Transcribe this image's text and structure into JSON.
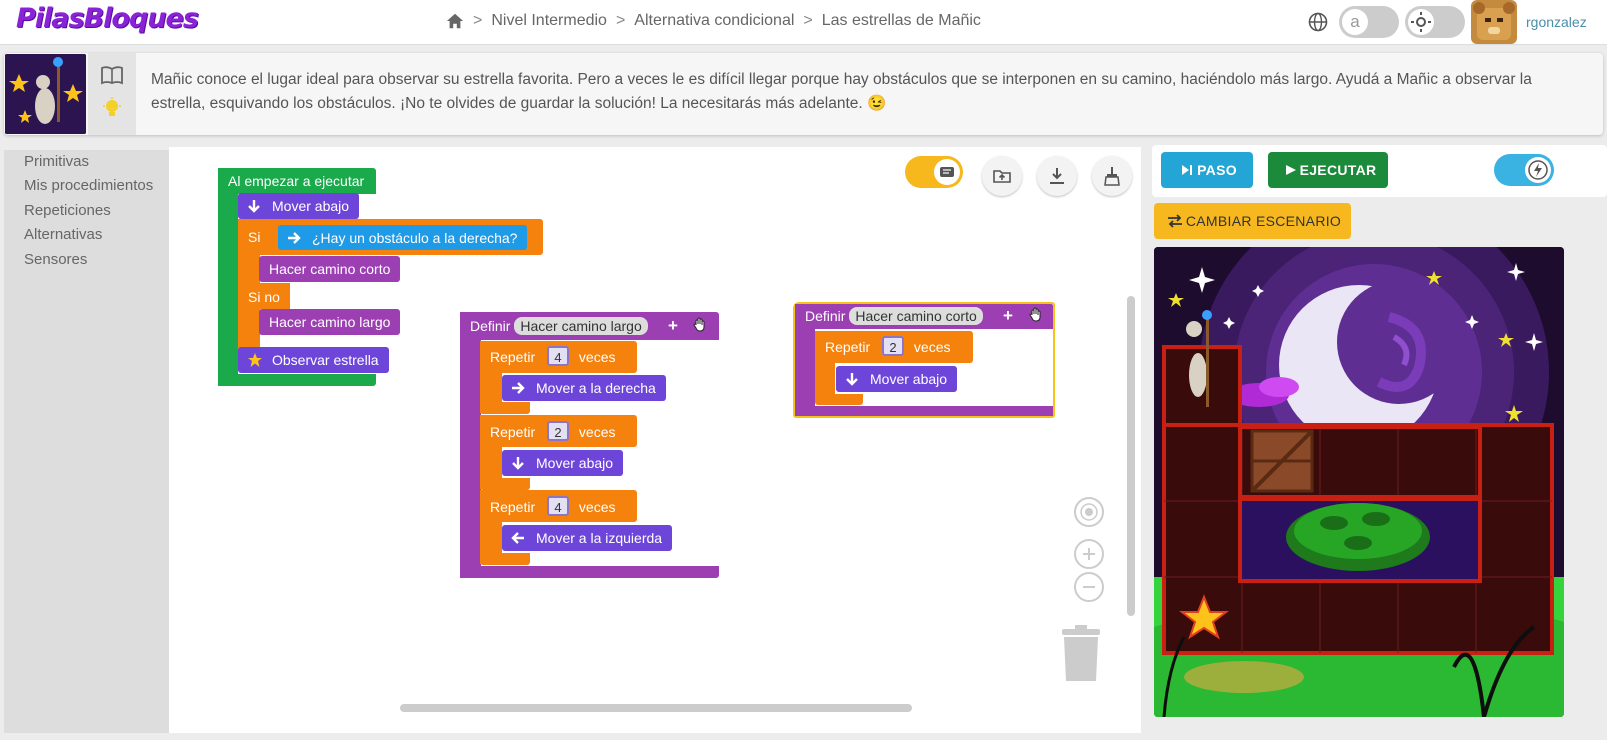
{
  "header": {
    "logo": "PilasBloques",
    "breadcrumb": [
      "Nivel Intermedio",
      "Alternativa condicional",
      "Las estrellas de Mañic"
    ],
    "separator": ">",
    "toggle_font_label": "a",
    "username": "rgonzalez"
  },
  "description": {
    "text": "Mañic conoce el lugar ideal para observar su estrella favorita. Pero a veces le es difícil llegar porque hay obstáculos que se interponen en su camino, haciéndolo más largo. Ayudá a Mañic a observar la estrella, esquivando los obstáculos. ¡No te olvides de guardar la solución! La necesitarás más adelante. 😉"
  },
  "toolbox": {
    "items": [
      "Primitivas",
      "Mis procedimientos",
      "Repeticiones",
      "Alternativas",
      "Sensores"
    ]
  },
  "workspace": {
    "main": {
      "hat": "Al empezar a ejecutar",
      "move_down": "Mover abajo",
      "if_label": "Si",
      "condition": "¿Hay un obstáculo a la derecha?",
      "short_path": "Hacer camino corto",
      "else_label": "Si no",
      "long_path": "Hacer camino largo",
      "observe": "Observar estrella"
    },
    "def_long": {
      "define": "Definir",
      "name": "Hacer camino largo",
      "plus": "+",
      "repeat_label": "Repetir",
      "times_label": "veces",
      "r1_count": "4",
      "r1_action": "Mover a la derecha",
      "r2_count": "2",
      "r2_action": "Mover abajo",
      "r3_count": "4",
      "r3_action": "Mover a la izquierda"
    },
    "def_short": {
      "define": "Definir",
      "name": "Hacer camino corto",
      "plus": "+",
      "repeat_label": "Repetir",
      "times_label": "veces",
      "count": "2",
      "action": "Mover abajo"
    }
  },
  "controls": {
    "step": "PASO",
    "run": "EJECUTAR",
    "change_scene": "CAMBIAR ESCENARIO"
  },
  "colors": {
    "event": "#1aaa4c",
    "control": "#f5820d",
    "procedure": "#9b3fb3",
    "action": "#6e45d9",
    "sensor": "#1f9ae6"
  }
}
